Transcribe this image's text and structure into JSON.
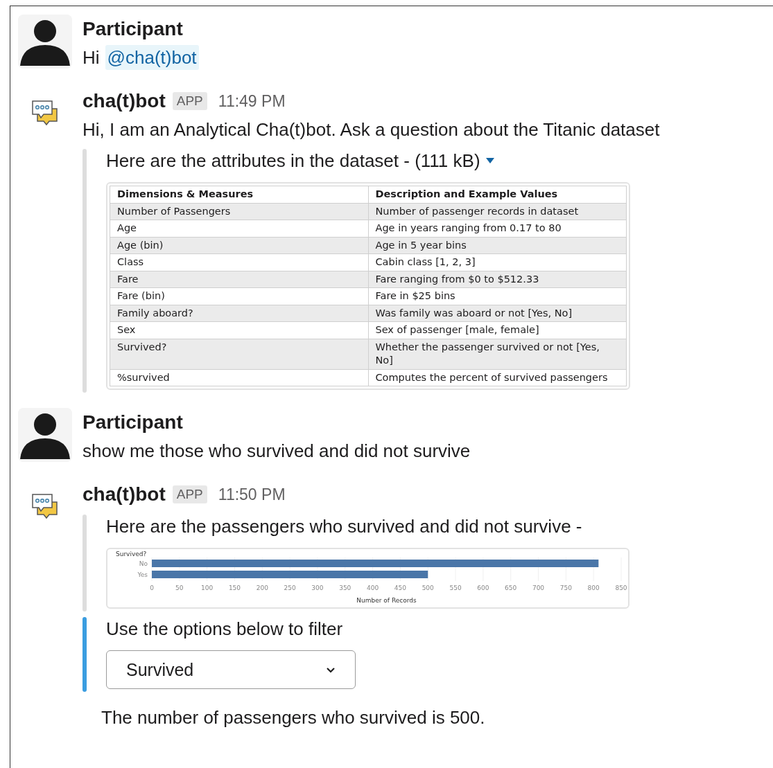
{
  "messages": [
    {
      "kind": "user",
      "author": "Participant",
      "text": "Hi",
      "mention": "@cha(t)bot"
    },
    {
      "kind": "bot",
      "author": "cha(t)bot",
      "badge": "APP",
      "time": "11:49 PM",
      "text": "Hi, I am an Analytical Cha(t)bot. Ask a question about the Titanic dataset",
      "attachments": [
        {
          "kind": "table",
          "accent": false,
          "title": "Here are the attributes in the dataset - (111 kB)",
          "columns": [
            "Dimensions & Measures",
            "Description and Example Values"
          ],
          "rows": [
            [
              "Number of Passengers",
              "Number of passenger records in dataset"
            ],
            [
              "Age",
              "Age in years ranging from 0.17 to 80"
            ],
            [
              "Age (bin)",
              "Age in 5 year bins"
            ],
            [
              "Class",
              "Cabin class [1, 2, 3]"
            ],
            [
              "Fare",
              "Fare ranging from $0 to $512.33"
            ],
            [
              "Fare (bin)",
              "Fare in $25 bins"
            ],
            [
              "Family aboard?",
              "Was family was aboard or not [Yes, No]"
            ],
            [
              "Sex",
              "Sex of passenger [male, female]"
            ],
            [
              "Survived?",
              "Whether the passenger survived or not [Yes, No]"
            ],
            [
              "%survived",
              "Computes the percent of survived passengers"
            ]
          ]
        }
      ]
    },
    {
      "kind": "user",
      "author": "Participant",
      "text": "show me those who survived and did not survive"
    },
    {
      "kind": "bot",
      "author": "cha(t)bot",
      "badge": "APP",
      "time": "11:50 PM",
      "attachments": [
        {
          "kind": "chart",
          "accent": false,
          "title": "Here are the passengers who survived and did not survive -",
          "chart_data": {
            "type": "bar",
            "orientation": "horizontal",
            "ylabel": "Survived?",
            "xlabel": "Number of Records",
            "categories": [
              "No",
              "Yes"
            ],
            "series": [
              {
                "color": "#4a76a8",
                "values": [
                  809,
                  500
                ]
              }
            ],
            "grid": true,
            "xlim": [
              0,
              850
            ],
            "xticks": [
              0,
              50,
              100,
              150,
              200,
              250,
              300,
              350,
              400,
              450,
              500,
              550,
              600,
              650,
              700,
              750,
              800,
              850
            ]
          }
        },
        {
          "kind": "filter",
          "accent": true,
          "title": "Use the options below to filter",
          "dropdown": {
            "value": "Survived"
          }
        }
      ],
      "footer": "The number of passengers who survived is 500."
    }
  ]
}
